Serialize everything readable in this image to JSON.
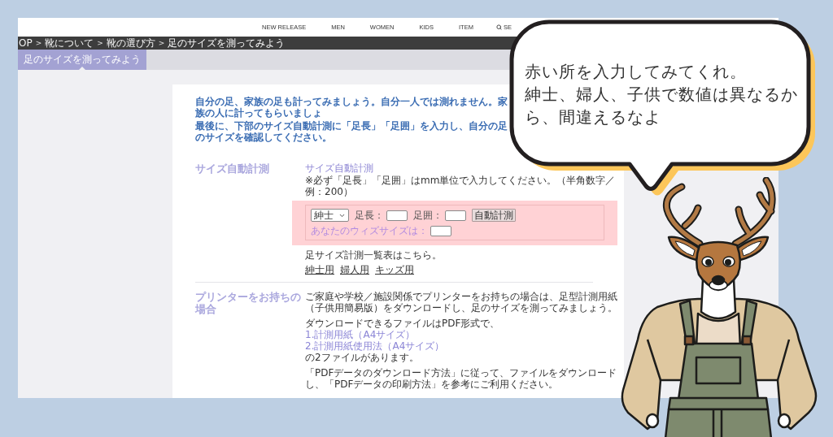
{
  "nav": {
    "items": [
      "NEW RELEASE",
      "MEN",
      "WOMEN",
      "KIDS",
      "ITEM"
    ],
    "search_label": "SE"
  },
  "breadcrumb": {
    "items": [
      "OP",
      "靴について",
      "靴の選び方",
      "足のサイズを測ってみよう"
    ],
    "separator": ">"
  },
  "tabs": [
    {
      "label": "足のサイズを測ってみよう",
      "selected": true
    }
  ],
  "intro": [
    "自分の足、家族の足も計ってみましょう。自分一人では測れません。家族の人に計ってもらいましょ",
    "最後に、下部のサイズ自動計測に「足長」「足囲」を入力し、自分の足のサイズを確認してください。"
  ],
  "auto_measure": {
    "heading": "サイズ自動計測",
    "label": "サイズ自動計測",
    "note": "※必ず「足長」「足囲」はmm単位で入力してください。（半角数字／例：200）",
    "form": {
      "gender": "紳士",
      "length_label": "足長：",
      "girth_label": "足囲：",
      "button": "自動計測",
      "result_label": "あなたのウィズサイズは："
    },
    "table_text": "足サイズ計測一覧表はこちら。",
    "links": [
      "紳士用",
      "婦人用",
      "キッズ用"
    ]
  },
  "printer": {
    "heading": "プリンターをお持ちの場合",
    "intro": "ご家庭や学校／施設関係でプリンターをお持ちの場合は、足型計測用紙（子供用簡易版）をダウンロードし、足のサイズを測ってみましょう。",
    "files_intro": "ダウンロードできるファイルはPDF形式で、",
    "files": [
      "1.計測用紙（A4サイズ）",
      "2.計測用紙使用法（A4サイズ）"
    ],
    "files_outro": "の2ファイルがあります。",
    "instructions": "「PDFデータのダウンロード方法」に従って、ファイルをダウンロードし、「PDFデータの印刷方法」を参考にご利用ください。"
  },
  "speech_bubble": {
    "lines": [
      "赤い所を入力してみてくれ。",
      "紳士、婦人、子供で数値は異なるから、間違えるなよ"
    ]
  }
}
